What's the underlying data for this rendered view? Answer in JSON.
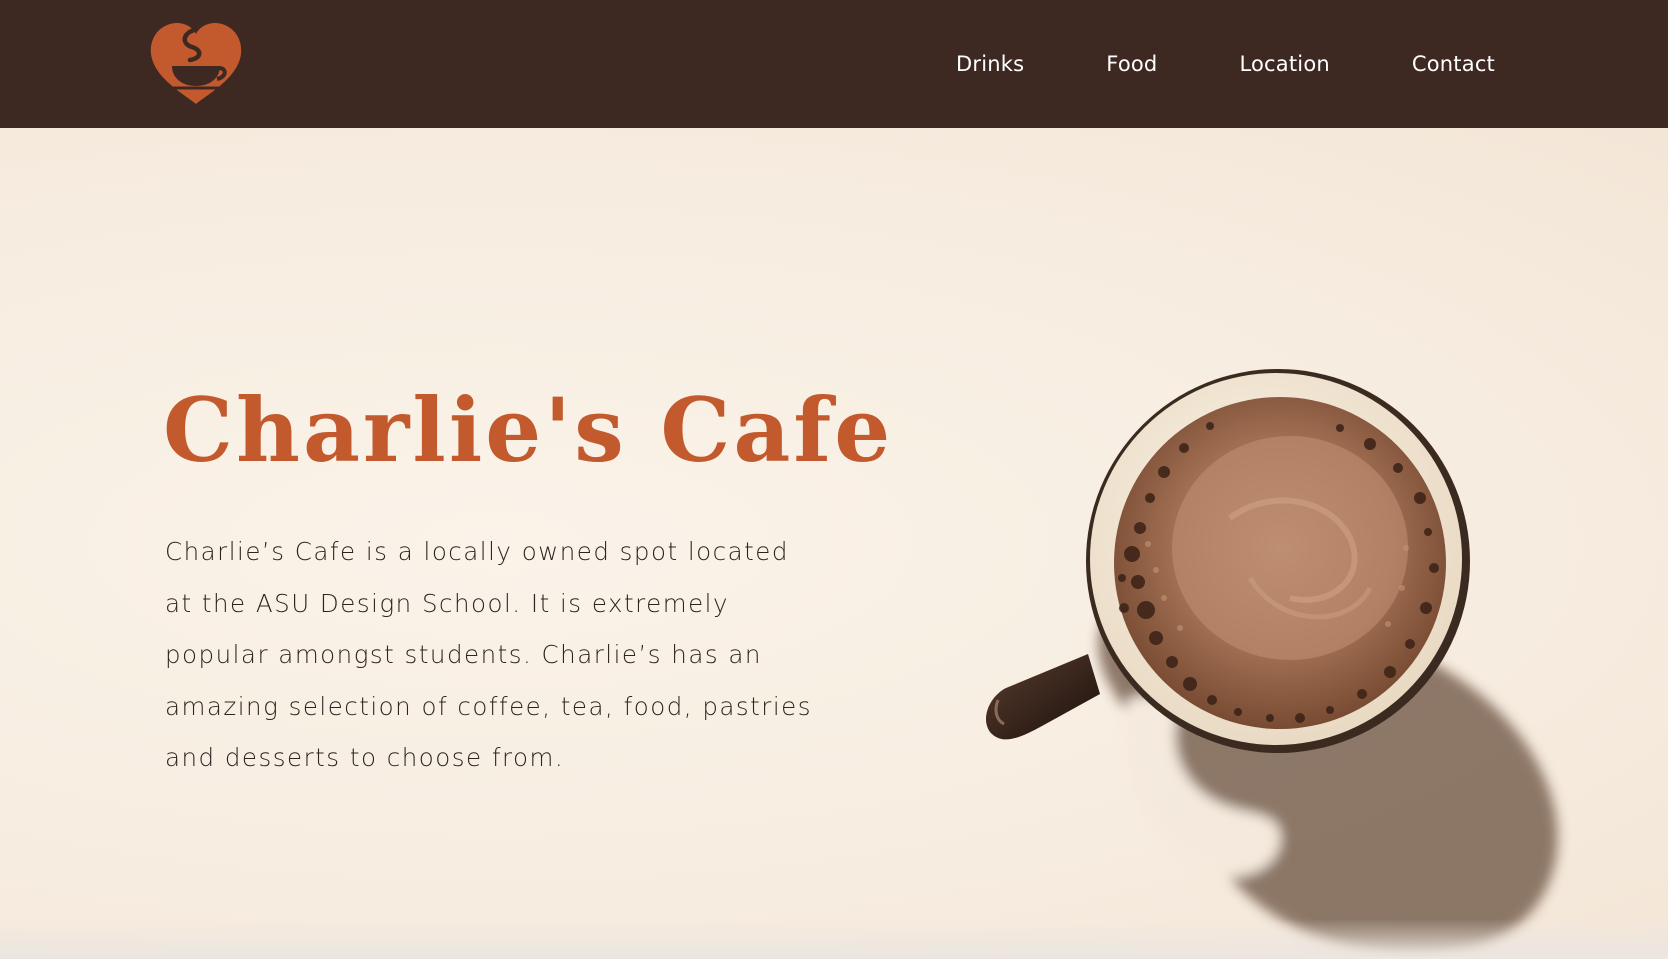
{
  "header": {
    "logo_icon": "coffee-heart-logo-icon",
    "nav": [
      {
        "label": "Drinks"
      },
      {
        "label": "Food"
      },
      {
        "label": "Location"
      },
      {
        "label": "Contact"
      }
    ]
  },
  "hero": {
    "title": "Charlie's Cafe",
    "description": "Charlie’s Cafe is a locally owned spot located at the ASU Design School. It is extremely popular amongst students. Charlie’s has an amazing selection of coffee, tea, food, pastries and desserts to choose from.",
    "image_icon": "coffee-mug-image"
  },
  "colors": {
    "header_bg": "#3d2922",
    "accent": "#c35a2e",
    "page_bg": "#f8efe4",
    "body_text": "#2d2420",
    "nav_text": "#ffffff"
  }
}
